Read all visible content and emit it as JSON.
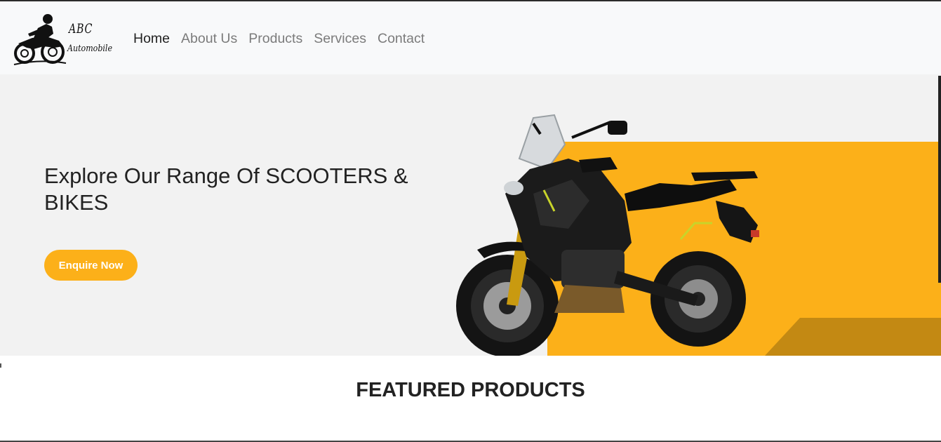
{
  "brand": {
    "name": "ABC",
    "subtitle": "Automobile"
  },
  "nav": {
    "items": [
      {
        "label": "Home",
        "active": true
      },
      {
        "label": "About Us",
        "active": false
      },
      {
        "label": "Products",
        "active": false
      },
      {
        "label": "Services",
        "active": false
      },
      {
        "label": "Contact",
        "active": false
      }
    ]
  },
  "hero": {
    "title": "Explore Our Range Of SCOOTERS & BIKES",
    "cta_label": "Enquire Now",
    "accent_color": "#fcb019",
    "image": "adventure-motorcycle-image"
  },
  "featured": {
    "title": "FEATURED PRODUCTS"
  },
  "colors": {
    "navbar_bg": "#f8f9fa",
    "hero_bg": "#f2f2f2",
    "accent": "#fcb019",
    "text": "#222222",
    "nav_muted": "#7b7b7b"
  }
}
